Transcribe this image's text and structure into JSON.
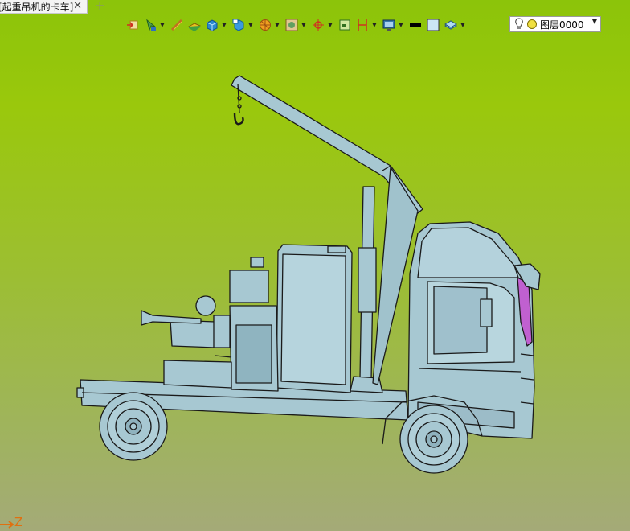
{
  "document_tab": {
    "title": "[起重吊机的卡车]",
    "close_glyph": "✕",
    "add_glyph": "+"
  },
  "toolbar": {
    "layer_field": {
      "value": "图层0000",
      "dropdown_glyph": "▼"
    }
  },
  "viewport": {
    "axis_label": "Z"
  },
  "colors": {
    "background_top": "#8cc40a",
    "background_bottom": "#a4aa78",
    "model_fill": "#a7c8d2",
    "model_edge": "#1a1a1a",
    "accent_purple": "#c060d0"
  }
}
